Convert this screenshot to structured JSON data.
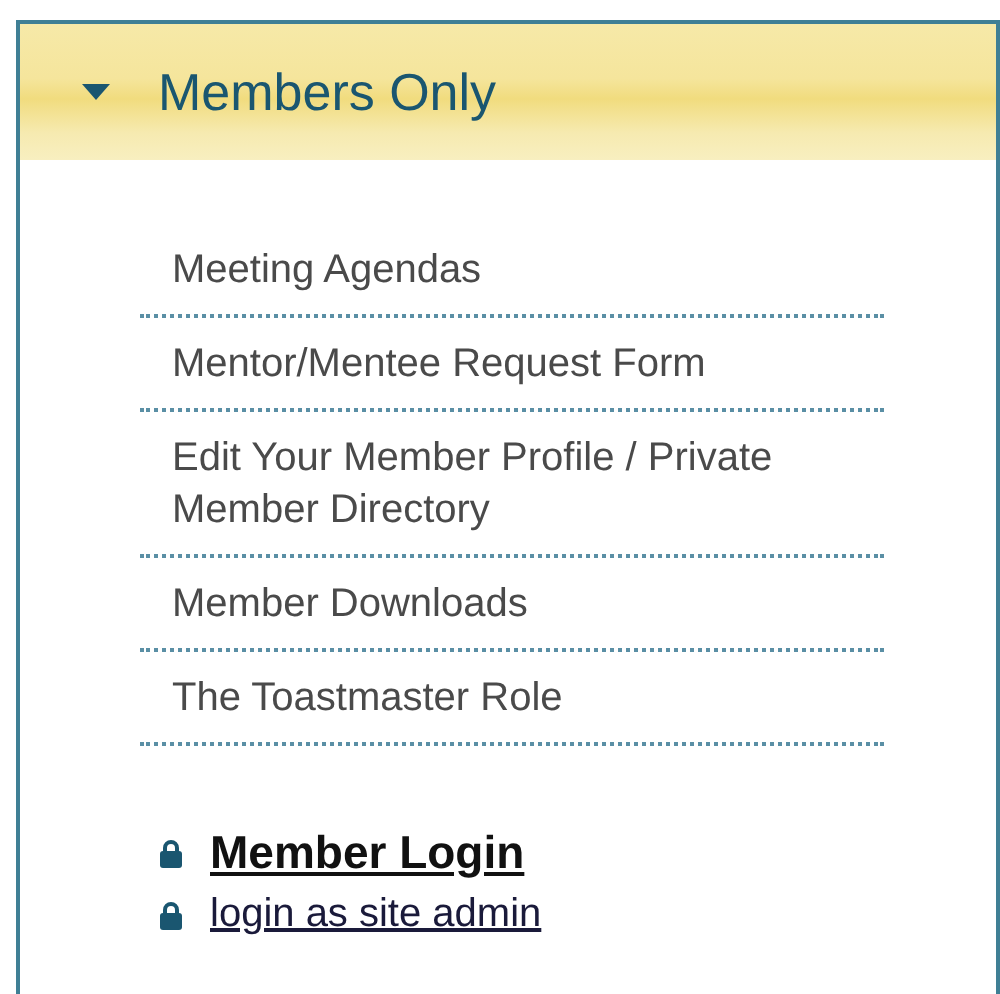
{
  "panel": {
    "title": "Members Only",
    "expanded": true
  },
  "links": [
    {
      "label": "Meeting Agendas"
    },
    {
      "label": "Mentor/Mentee Request Form"
    },
    {
      "label": "Edit Your Member Profile / Private Member Directory"
    },
    {
      "label": "Member Downloads"
    },
    {
      "label": "The Toastmaster Role"
    }
  ],
  "logins": [
    {
      "label": "Member Login",
      "kind": "primary"
    },
    {
      "label": "login as site admin",
      "kind": "secondary"
    }
  ]
}
